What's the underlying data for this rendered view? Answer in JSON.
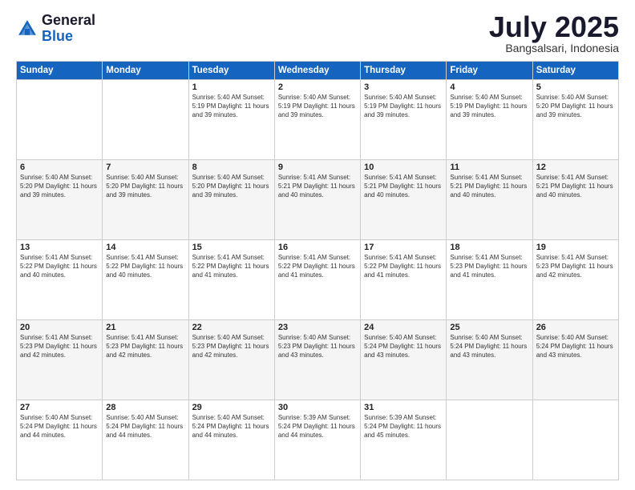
{
  "header": {
    "logo_general": "General",
    "logo_blue": "Blue",
    "month_title": "July 2025",
    "location": "Bangsalsari, Indonesia"
  },
  "days_of_week": [
    "Sunday",
    "Monday",
    "Tuesday",
    "Wednesday",
    "Thursday",
    "Friday",
    "Saturday"
  ],
  "weeks": [
    [
      {
        "day": "",
        "info": ""
      },
      {
        "day": "",
        "info": ""
      },
      {
        "day": "1",
        "info": "Sunrise: 5:40 AM\nSunset: 5:19 PM\nDaylight: 11 hours and 39 minutes."
      },
      {
        "day": "2",
        "info": "Sunrise: 5:40 AM\nSunset: 5:19 PM\nDaylight: 11 hours and 39 minutes."
      },
      {
        "day": "3",
        "info": "Sunrise: 5:40 AM\nSunset: 5:19 PM\nDaylight: 11 hours and 39 minutes."
      },
      {
        "day": "4",
        "info": "Sunrise: 5:40 AM\nSunset: 5:19 PM\nDaylight: 11 hours and 39 minutes."
      },
      {
        "day": "5",
        "info": "Sunrise: 5:40 AM\nSunset: 5:20 PM\nDaylight: 11 hours and 39 minutes."
      }
    ],
    [
      {
        "day": "6",
        "info": "Sunrise: 5:40 AM\nSunset: 5:20 PM\nDaylight: 11 hours and 39 minutes."
      },
      {
        "day": "7",
        "info": "Sunrise: 5:40 AM\nSunset: 5:20 PM\nDaylight: 11 hours and 39 minutes."
      },
      {
        "day": "8",
        "info": "Sunrise: 5:40 AM\nSunset: 5:20 PM\nDaylight: 11 hours and 39 minutes."
      },
      {
        "day": "9",
        "info": "Sunrise: 5:41 AM\nSunset: 5:21 PM\nDaylight: 11 hours and 40 minutes."
      },
      {
        "day": "10",
        "info": "Sunrise: 5:41 AM\nSunset: 5:21 PM\nDaylight: 11 hours and 40 minutes."
      },
      {
        "day": "11",
        "info": "Sunrise: 5:41 AM\nSunset: 5:21 PM\nDaylight: 11 hours and 40 minutes."
      },
      {
        "day": "12",
        "info": "Sunrise: 5:41 AM\nSunset: 5:21 PM\nDaylight: 11 hours and 40 minutes."
      }
    ],
    [
      {
        "day": "13",
        "info": "Sunrise: 5:41 AM\nSunset: 5:22 PM\nDaylight: 11 hours and 40 minutes."
      },
      {
        "day": "14",
        "info": "Sunrise: 5:41 AM\nSunset: 5:22 PM\nDaylight: 11 hours and 40 minutes."
      },
      {
        "day": "15",
        "info": "Sunrise: 5:41 AM\nSunset: 5:22 PM\nDaylight: 11 hours and 41 minutes."
      },
      {
        "day": "16",
        "info": "Sunrise: 5:41 AM\nSunset: 5:22 PM\nDaylight: 11 hours and 41 minutes."
      },
      {
        "day": "17",
        "info": "Sunrise: 5:41 AM\nSunset: 5:22 PM\nDaylight: 11 hours and 41 minutes."
      },
      {
        "day": "18",
        "info": "Sunrise: 5:41 AM\nSunset: 5:23 PM\nDaylight: 11 hours and 41 minutes."
      },
      {
        "day": "19",
        "info": "Sunrise: 5:41 AM\nSunset: 5:23 PM\nDaylight: 11 hours and 42 minutes."
      }
    ],
    [
      {
        "day": "20",
        "info": "Sunrise: 5:41 AM\nSunset: 5:23 PM\nDaylight: 11 hours and 42 minutes."
      },
      {
        "day": "21",
        "info": "Sunrise: 5:41 AM\nSunset: 5:23 PM\nDaylight: 11 hours and 42 minutes."
      },
      {
        "day": "22",
        "info": "Sunrise: 5:40 AM\nSunset: 5:23 PM\nDaylight: 11 hours and 42 minutes."
      },
      {
        "day": "23",
        "info": "Sunrise: 5:40 AM\nSunset: 5:23 PM\nDaylight: 11 hours and 43 minutes."
      },
      {
        "day": "24",
        "info": "Sunrise: 5:40 AM\nSunset: 5:24 PM\nDaylight: 11 hours and 43 minutes."
      },
      {
        "day": "25",
        "info": "Sunrise: 5:40 AM\nSunset: 5:24 PM\nDaylight: 11 hours and 43 minutes."
      },
      {
        "day": "26",
        "info": "Sunrise: 5:40 AM\nSunset: 5:24 PM\nDaylight: 11 hours and 43 minutes."
      }
    ],
    [
      {
        "day": "27",
        "info": "Sunrise: 5:40 AM\nSunset: 5:24 PM\nDaylight: 11 hours and 44 minutes."
      },
      {
        "day": "28",
        "info": "Sunrise: 5:40 AM\nSunset: 5:24 PM\nDaylight: 11 hours and 44 minutes."
      },
      {
        "day": "29",
        "info": "Sunrise: 5:40 AM\nSunset: 5:24 PM\nDaylight: 11 hours and 44 minutes."
      },
      {
        "day": "30",
        "info": "Sunrise: 5:39 AM\nSunset: 5:24 PM\nDaylight: 11 hours and 44 minutes."
      },
      {
        "day": "31",
        "info": "Sunrise: 5:39 AM\nSunset: 5:24 PM\nDaylight: 11 hours and 45 minutes."
      },
      {
        "day": "",
        "info": ""
      },
      {
        "day": "",
        "info": ""
      }
    ]
  ]
}
